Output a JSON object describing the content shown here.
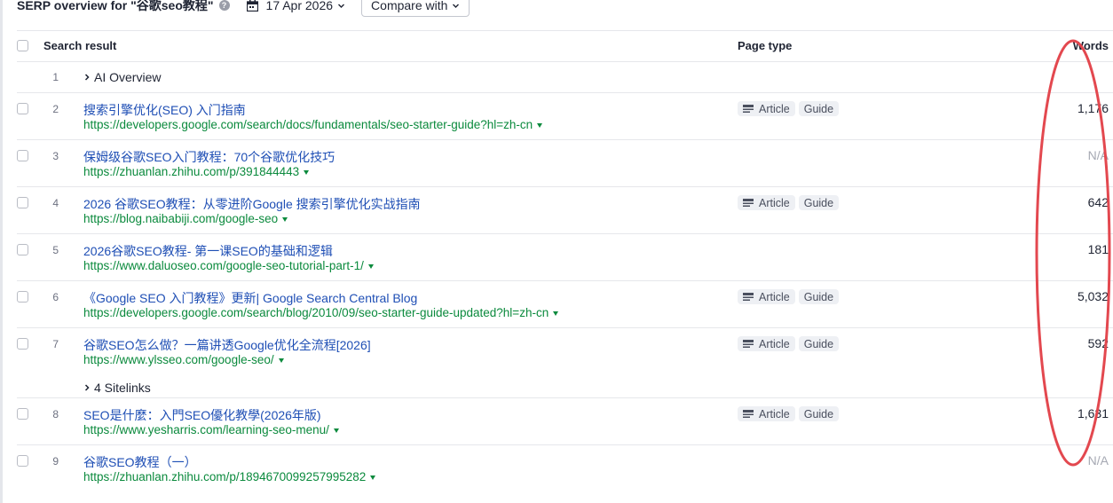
{
  "header": {
    "title": "SERP overview for \"谷歌seo教程\"",
    "help_glyph": "?",
    "date": "17 Apr 2026",
    "compare_label": "Compare with"
  },
  "table": {
    "columns": {
      "search_result": "Search result",
      "page_type": "Page type",
      "words": "Words"
    },
    "ai_overview": {
      "rank": "1",
      "label": "AI Overview"
    },
    "rows": [
      {
        "rank": "2",
        "title": "搜索引擎优化(SEO) 入门指南",
        "url": "https://developers.google.com/search/docs/fundamentals/seo-starter-guide?hl=zh-cn",
        "badges": [
          "Article",
          "Guide"
        ],
        "words": "1,176"
      },
      {
        "rank": "3",
        "title": "保姆级谷歌SEO入门教程：70个谷歌优化技巧",
        "url": "https://zhuanlan.zhihu.com/p/391844443",
        "badges": [],
        "words": "N/A"
      },
      {
        "rank": "4",
        "title": "2026 谷歌SEO教程：从零进阶Google 搜索引擎优化实战指南",
        "url": "https://blog.naibabiji.com/google-seo",
        "badges": [
          "Article",
          "Guide"
        ],
        "words": "642"
      },
      {
        "rank": "5",
        "title": "2026谷歌SEO教程- 第一课SEO的基础和逻辑",
        "url": "https://www.daluoseo.com/google-seo-tutorial-part-1/",
        "badges": [],
        "words": "181"
      },
      {
        "rank": "6",
        "title": "《Google SEO 入门教程》更新| Google Search Central Blog",
        "url": "https://developers.google.com/search/blog/2010/09/seo-starter-guide-updated?hl=zh-cn",
        "badges": [
          "Article",
          "Guide"
        ],
        "words": "5,032"
      },
      {
        "rank": "7",
        "title": "谷歌SEO怎么做？一篇讲透Google优化全流程[2026]",
        "url": "https://www.ylsseo.com/google-seo/",
        "badges": [
          "Article",
          "Guide"
        ],
        "words": "592",
        "sitelinks": "4 Sitelinks"
      },
      {
        "rank": "8",
        "title": "SEO是什麼：入門SEO優化教學(2026年版)",
        "url": "https://www.yesharris.com/learning-seo-menu/",
        "badges": [
          "Article",
          "Guide"
        ],
        "words": "1,631"
      },
      {
        "rank": "9",
        "title": "谷歌SEO教程（一）",
        "url": "https://zhuanlan.zhihu.com/p/1894670099257995282",
        "badges": [],
        "words": "N/A"
      }
    ]
  },
  "annotation_color": "#e3484f"
}
